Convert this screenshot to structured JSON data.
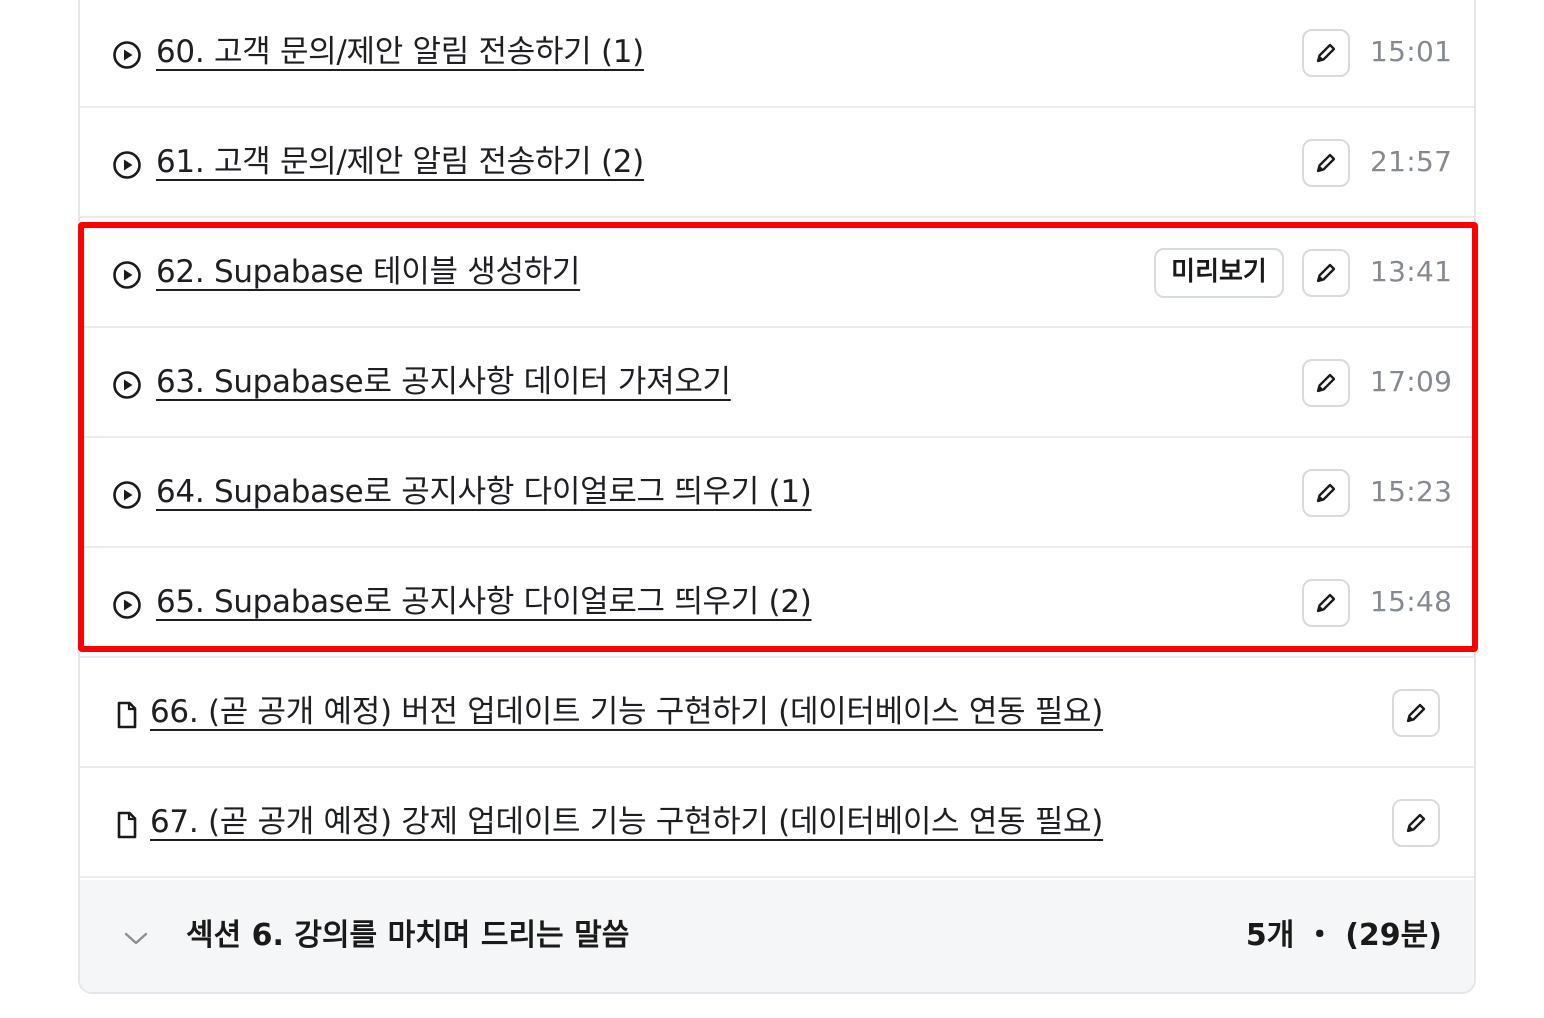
{
  "lessons": [
    {
      "title": "60. 고객 문의/제안 알림 전송하기 (1)",
      "duration": "15:01",
      "type": "video"
    },
    {
      "title": "61. 고객 문의/제안 알림 전송하기 (2)",
      "duration": "21:57",
      "type": "video"
    },
    {
      "title": "62. Supabase 테이블 생성하기",
      "duration": "13:41",
      "type": "video",
      "preview_label": "미리보기"
    },
    {
      "title": "63. Supabase로 공지사항 데이터 가져오기",
      "duration": "17:09",
      "type": "video"
    },
    {
      "title": "64. Supabase로 공지사항 다이얼로그 띄우기 (1)",
      "duration": "15:23",
      "type": "video"
    },
    {
      "title": "65. Supabase로 공지사항 다이얼로그 띄우기 (2)",
      "duration": "15:48",
      "type": "video"
    },
    {
      "title": "66. (곧 공개 예정) 버전 업데이트 기능 구현하기 (데이터베이스 연동 필요)",
      "type": "document"
    },
    {
      "title": "67. (곧 공개 예정) 강제 업데이트 기능 구현하기 (데이터베이스 연동 필요)",
      "type": "document"
    }
  ],
  "section": {
    "title": "섹션 6. 강의를 마치며 드리는 말씀",
    "meta": "5개 ・ (29분)"
  },
  "icons": {
    "video": "play-circle-icon",
    "document": "document-icon",
    "edit": "pencil-icon",
    "collapse": "chevron-down-icon"
  },
  "colors": {
    "highlight": "#ff0000",
    "duration": "#858a92",
    "border": "#e4e6ea",
    "section_bg": "#f5f6f8"
  }
}
